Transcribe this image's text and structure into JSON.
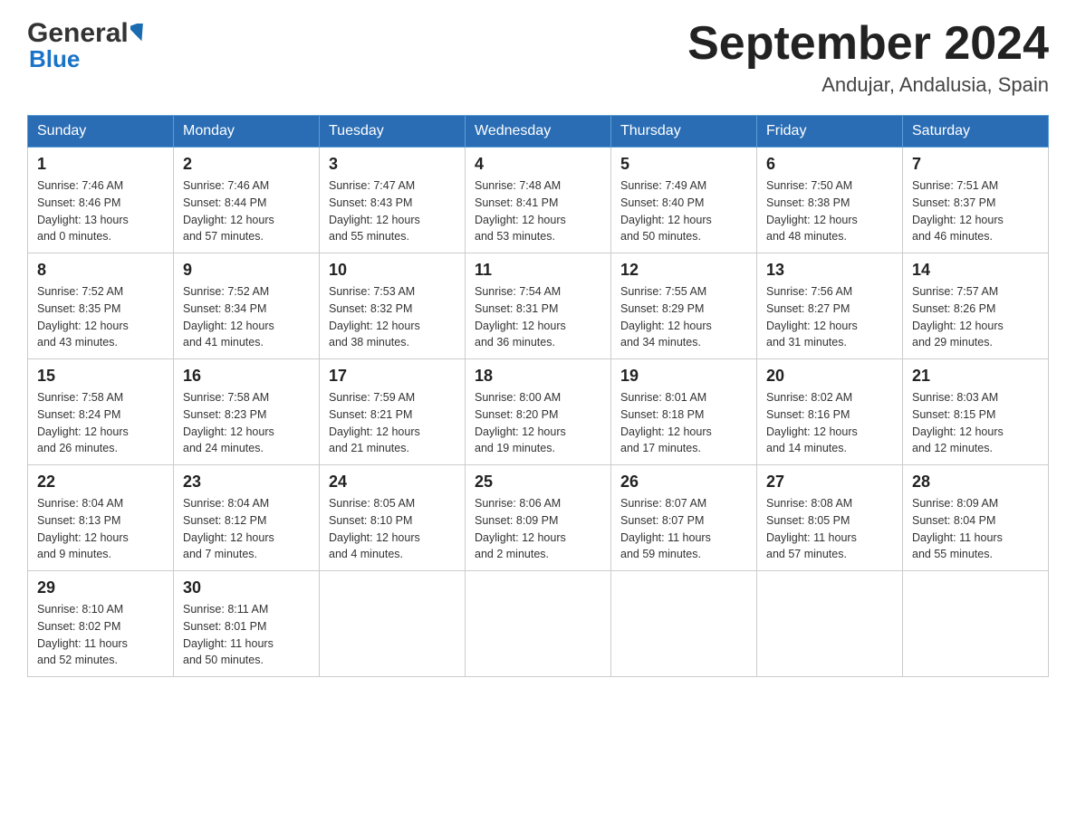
{
  "header": {
    "logo": {
      "general": "General",
      "blue": "Blue",
      "alt": "GeneralBlue logo"
    },
    "title": "September 2024",
    "subtitle": "Andujar, Andalusia, Spain"
  },
  "calendar": {
    "weekdays": [
      "Sunday",
      "Monday",
      "Tuesday",
      "Wednesday",
      "Thursday",
      "Friday",
      "Saturday"
    ],
    "weeks": [
      [
        {
          "day": "1",
          "sunrise": "7:46 AM",
          "sunset": "8:46 PM",
          "daylight": "13 hours and 0 minutes."
        },
        {
          "day": "2",
          "sunrise": "7:46 AM",
          "sunset": "8:44 PM",
          "daylight": "12 hours and 57 minutes."
        },
        {
          "day": "3",
          "sunrise": "7:47 AM",
          "sunset": "8:43 PM",
          "daylight": "12 hours and 55 minutes."
        },
        {
          "day": "4",
          "sunrise": "7:48 AM",
          "sunset": "8:41 PM",
          "daylight": "12 hours and 53 minutes."
        },
        {
          "day": "5",
          "sunrise": "7:49 AM",
          "sunset": "8:40 PM",
          "daylight": "12 hours and 50 minutes."
        },
        {
          "day": "6",
          "sunrise": "7:50 AM",
          "sunset": "8:38 PM",
          "daylight": "12 hours and 48 minutes."
        },
        {
          "day": "7",
          "sunrise": "7:51 AM",
          "sunset": "8:37 PM",
          "daylight": "12 hours and 46 minutes."
        }
      ],
      [
        {
          "day": "8",
          "sunrise": "7:52 AM",
          "sunset": "8:35 PM",
          "daylight": "12 hours and 43 minutes."
        },
        {
          "day": "9",
          "sunrise": "7:52 AM",
          "sunset": "8:34 PM",
          "daylight": "12 hours and 41 minutes."
        },
        {
          "day": "10",
          "sunrise": "7:53 AM",
          "sunset": "8:32 PM",
          "daylight": "12 hours and 38 minutes."
        },
        {
          "day": "11",
          "sunrise": "7:54 AM",
          "sunset": "8:31 PM",
          "daylight": "12 hours and 36 minutes."
        },
        {
          "day": "12",
          "sunrise": "7:55 AM",
          "sunset": "8:29 PM",
          "daylight": "12 hours and 34 minutes."
        },
        {
          "day": "13",
          "sunrise": "7:56 AM",
          "sunset": "8:27 PM",
          "daylight": "12 hours and 31 minutes."
        },
        {
          "day": "14",
          "sunrise": "7:57 AM",
          "sunset": "8:26 PM",
          "daylight": "12 hours and 29 minutes."
        }
      ],
      [
        {
          "day": "15",
          "sunrise": "7:58 AM",
          "sunset": "8:24 PM",
          "daylight": "12 hours and 26 minutes."
        },
        {
          "day": "16",
          "sunrise": "7:58 AM",
          "sunset": "8:23 PM",
          "daylight": "12 hours and 24 minutes."
        },
        {
          "day": "17",
          "sunrise": "7:59 AM",
          "sunset": "8:21 PM",
          "daylight": "12 hours and 21 minutes."
        },
        {
          "day": "18",
          "sunrise": "8:00 AM",
          "sunset": "8:20 PM",
          "daylight": "12 hours and 19 minutes."
        },
        {
          "day": "19",
          "sunrise": "8:01 AM",
          "sunset": "8:18 PM",
          "daylight": "12 hours and 17 minutes."
        },
        {
          "day": "20",
          "sunrise": "8:02 AM",
          "sunset": "8:16 PM",
          "daylight": "12 hours and 14 minutes."
        },
        {
          "day": "21",
          "sunrise": "8:03 AM",
          "sunset": "8:15 PM",
          "daylight": "12 hours and 12 minutes."
        }
      ],
      [
        {
          "day": "22",
          "sunrise": "8:04 AM",
          "sunset": "8:13 PM",
          "daylight": "12 hours and 9 minutes."
        },
        {
          "day": "23",
          "sunrise": "8:04 AM",
          "sunset": "8:12 PM",
          "daylight": "12 hours and 7 minutes."
        },
        {
          "day": "24",
          "sunrise": "8:05 AM",
          "sunset": "8:10 PM",
          "daylight": "12 hours and 4 minutes."
        },
        {
          "day": "25",
          "sunrise": "8:06 AM",
          "sunset": "8:09 PM",
          "daylight": "12 hours and 2 minutes."
        },
        {
          "day": "26",
          "sunrise": "8:07 AM",
          "sunset": "8:07 PM",
          "daylight": "11 hours and 59 minutes."
        },
        {
          "day": "27",
          "sunrise": "8:08 AM",
          "sunset": "8:05 PM",
          "daylight": "11 hours and 57 minutes."
        },
        {
          "day": "28",
          "sunrise": "8:09 AM",
          "sunset": "8:04 PM",
          "daylight": "11 hours and 55 minutes."
        }
      ],
      [
        {
          "day": "29",
          "sunrise": "8:10 AM",
          "sunset": "8:02 PM",
          "daylight": "11 hours and 52 minutes."
        },
        {
          "day": "30",
          "sunrise": "8:11 AM",
          "sunset": "8:01 PM",
          "daylight": "11 hours and 50 minutes."
        },
        null,
        null,
        null,
        null,
        null
      ]
    ]
  },
  "labels": {
    "sunrise": "Sunrise:",
    "sunset": "Sunset:",
    "daylight": "Daylight:"
  }
}
